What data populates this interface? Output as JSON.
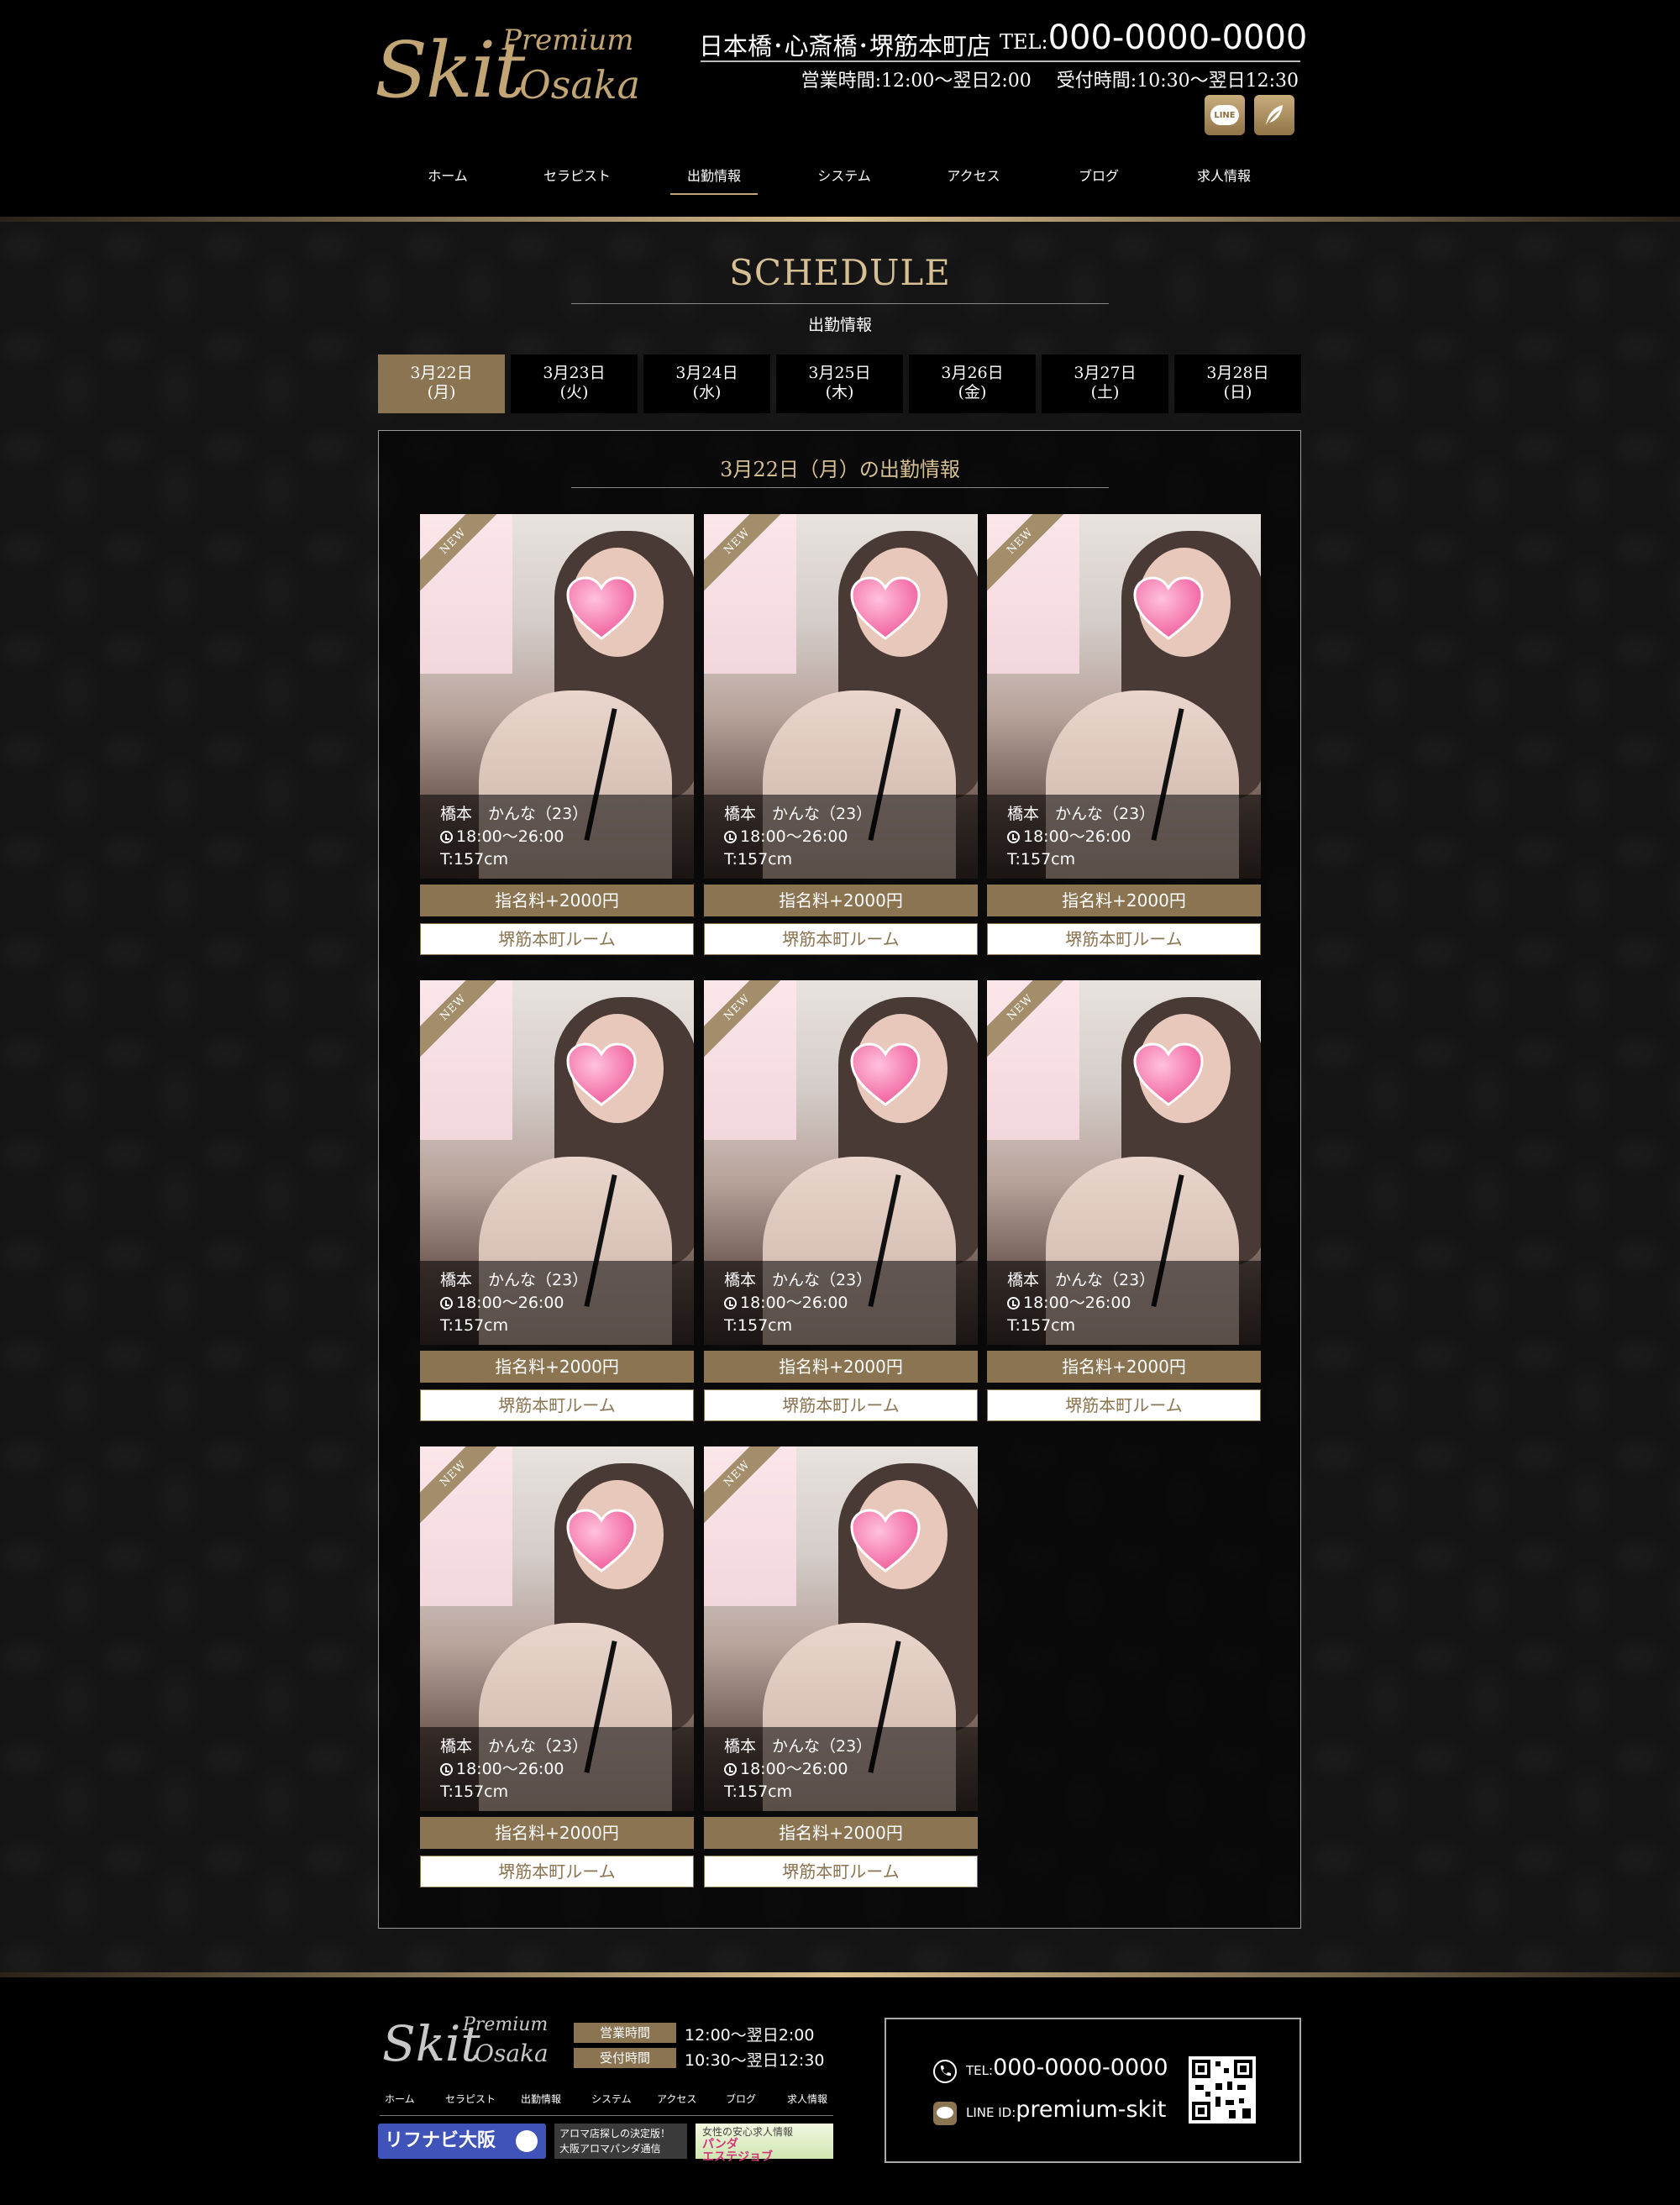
{
  "header": {
    "logo_premium": "Premium",
    "logo_skit": "Skit",
    "logo_osaka": "Osaka",
    "shop_name": "日本橋･心斎橋･堺筋本町店",
    "tel_prefix": "TEL:",
    "tel_number": "000-0000-0000",
    "business_hours": "営業時間:12:00～翌日2:00",
    "reception_hours": "受付時間:10:30～翌日12:30",
    "line_icon_label": "LINE",
    "nav": [
      {
        "label": "ホーム",
        "active": false
      },
      {
        "label": "セラピスト",
        "active": false
      },
      {
        "label": "出勤情報",
        "active": true
      },
      {
        "label": "システム",
        "active": false
      },
      {
        "label": "アクセス",
        "active": false
      },
      {
        "label": "ブログ",
        "active": false
      },
      {
        "label": "求人情報",
        "active": false
      }
    ]
  },
  "main": {
    "title": "SCHEDULE",
    "subtitle": "出勤情報",
    "date_tabs": [
      {
        "date": "3月22日",
        "day": "(月)",
        "active": true
      },
      {
        "date": "3月23日",
        "day": "(火)",
        "active": false
      },
      {
        "date": "3月24日",
        "day": "(水)",
        "active": false
      },
      {
        "date": "3月25日",
        "day": "(木)",
        "active": false
      },
      {
        "date": "3月26日",
        "day": "(金)",
        "active": false
      },
      {
        "date": "3月27日",
        "day": "(土)",
        "active": false
      },
      {
        "date": "3月28日",
        "day": "(日)",
        "active": false
      }
    ],
    "box_title": "3月22日（月）の出勤情報",
    "cards": [
      {
        "badge": "NEW",
        "name": "橋本　かんな（23）",
        "time": "18:00～26:00",
        "height": "T:157cm",
        "fee": "指名料+2000円",
        "room": "堺筋本町ルーム"
      },
      {
        "badge": "NEW",
        "name": "橋本　かんな（23）",
        "time": "18:00～26:00",
        "height": "T:157cm",
        "fee": "指名料+2000円",
        "room": "堺筋本町ルーム"
      },
      {
        "badge": "NEW",
        "name": "橋本　かんな（23）",
        "time": "18:00～26:00",
        "height": "T:157cm",
        "fee": "指名料+2000円",
        "room": "堺筋本町ルーム"
      },
      {
        "badge": "NEW",
        "name": "橋本　かんな（23）",
        "time": "18:00～26:00",
        "height": "T:157cm",
        "fee": "指名料+2000円",
        "room": "堺筋本町ルーム"
      },
      {
        "badge": "NEW",
        "name": "橋本　かんな（23）",
        "time": "18:00～26:00",
        "height": "T:157cm",
        "fee": "指名料+2000円",
        "room": "堺筋本町ルーム"
      },
      {
        "badge": "NEW",
        "name": "橋本　かんな（23）",
        "time": "18:00～26:00",
        "height": "T:157cm",
        "fee": "指名料+2000円",
        "room": "堺筋本町ルーム"
      },
      {
        "badge": "NEW",
        "name": "橋本　かんな（23）",
        "time": "18:00～26:00",
        "height": "T:157cm",
        "fee": "指名料+2000円",
        "room": "堺筋本町ルーム"
      },
      {
        "badge": "NEW",
        "name": "橋本　かんな（23）",
        "time": "18:00～26:00",
        "height": "T:157cm",
        "fee": "指名料+2000円",
        "room": "堺筋本町ルーム"
      }
    ]
  },
  "footer": {
    "logo_premium": "Premium",
    "logo_skit": "Skit",
    "logo_osaka": "Osaka",
    "business_label": "営業時間",
    "business_value": "12:00～翌日2:00",
    "reception_label": "受付時間",
    "reception_value": "10:30～翌日12:30",
    "nav": [
      "ホーム",
      "セラピスト",
      "出勤情報",
      "システム",
      "アクセス",
      "ブログ",
      "求人情報"
    ],
    "banner_1": "リフナビ大阪",
    "banner_2_line1": "アロマ店探しの決定版！",
    "banner_2_line2": "大阪アロマパンダ通信",
    "banner_3_line1": "女性の安心求人情報",
    "banner_3_line2": "パンダ",
    "banner_3_line3": "エステジョブ",
    "tel_prefix": "TEL:",
    "tel_number": "000-0000-0000",
    "line_prefix": "LINE ID:",
    "line_id": "premium-skit"
  },
  "colors": {
    "accent_gold": "#c2a574",
    "tab_active": "#8a7452",
    "background": "#141414"
  },
  "icons": [
    "line-icon",
    "feather-icon",
    "clock-icon",
    "phone-icon",
    "heart-icon",
    "qr-code-icon"
  ]
}
